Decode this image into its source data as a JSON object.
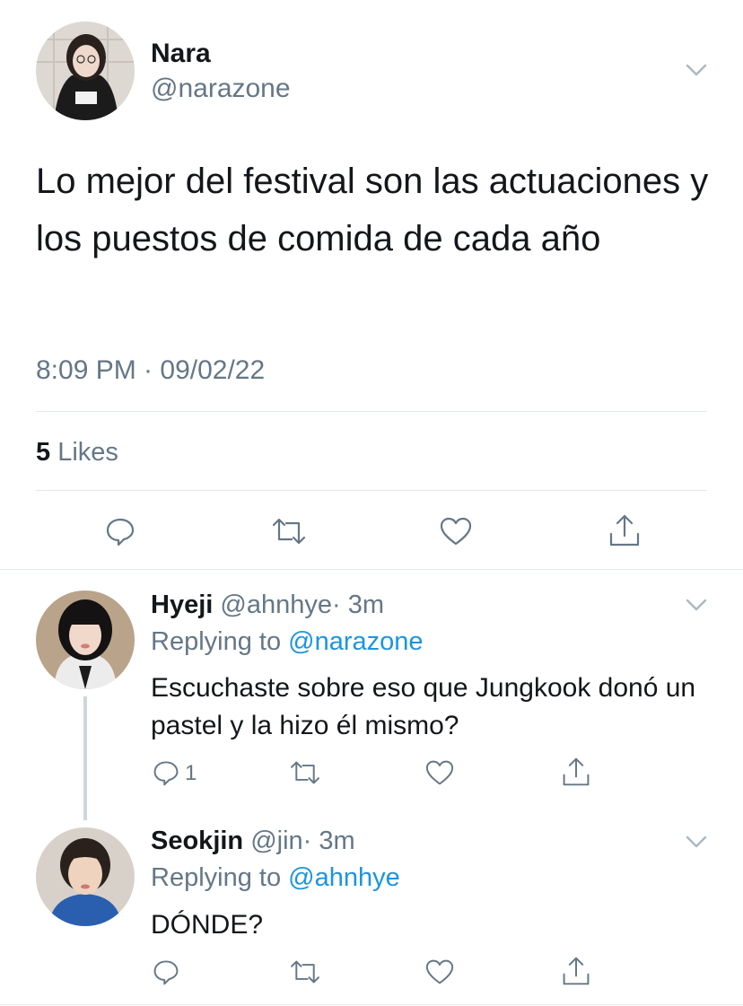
{
  "main_tweet": {
    "name": "Nara",
    "handle": "@narazone",
    "text": "Lo mejor del festival son las actuaciones y los puestos de comida de cada año",
    "timestamp": "8:09 PM · 09/02/22",
    "likes_count": "5",
    "likes_label": "Likes"
  },
  "replies": [
    {
      "name": "Hyeji",
      "handle": "@ahnhye",
      "time": "· 3m",
      "replying_label": "Replying to",
      "replying_to": "@narazone",
      "text": "Escuchaste sobre eso que Jungkook donó un pastel y la hizo él mismo?",
      "reply_count": "1"
    },
    {
      "name": "Seokjin",
      "handle": "@jin",
      "time": "· 3m",
      "replying_label": "Replying to",
      "replying_to": "@ahnhye",
      "text": "DÓNDE?",
      "reply_count": ""
    }
  ],
  "colors": {
    "text": "#14171a",
    "secondary": "#657786",
    "link": "#1b95e0",
    "divider": "#e1e8ed"
  },
  "icons": [
    "chevron-down-icon",
    "reply-icon",
    "retweet-icon",
    "like-icon",
    "share-icon"
  ]
}
